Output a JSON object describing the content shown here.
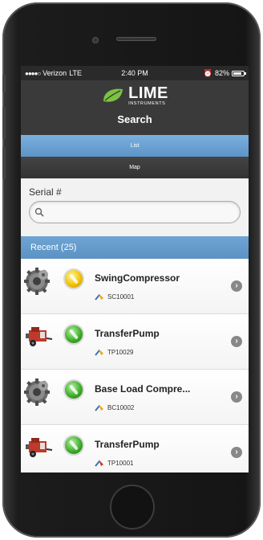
{
  "status_bar": {
    "carrier": "Verizon",
    "network": "LTE",
    "time": "2:40 PM",
    "battery": "82%",
    "battery_level": 0.82
  },
  "header": {
    "logo_main": "LIME",
    "logo_sub": "INSTRUMENTS",
    "title": "Search"
  },
  "tabs": {
    "list": "List",
    "map": "Map"
  },
  "search": {
    "label": "Serial #",
    "value": "",
    "placeholder": ""
  },
  "recent": {
    "label": "Recent (25)"
  },
  "items": [
    {
      "name": "SwingCompressor",
      "serial": "SC10001",
      "status": "yellow",
      "icon": "gear-icon"
    },
    {
      "name": "TransferPump",
      "serial": "TP10029",
      "status": "green",
      "icon": "pump-trailer-icon"
    },
    {
      "name": "Base Load Compre...",
      "serial": "BC10002",
      "status": "green",
      "icon": "gear-icon"
    },
    {
      "name": "TransferPump",
      "serial": "TP10001",
      "status": "green",
      "icon": "pump-trailer-icon"
    }
  ],
  "colors": {
    "accent_blue": "#6a9fcf",
    "header_dark": "#3a3a3a",
    "lime_green": "#7cc242"
  }
}
